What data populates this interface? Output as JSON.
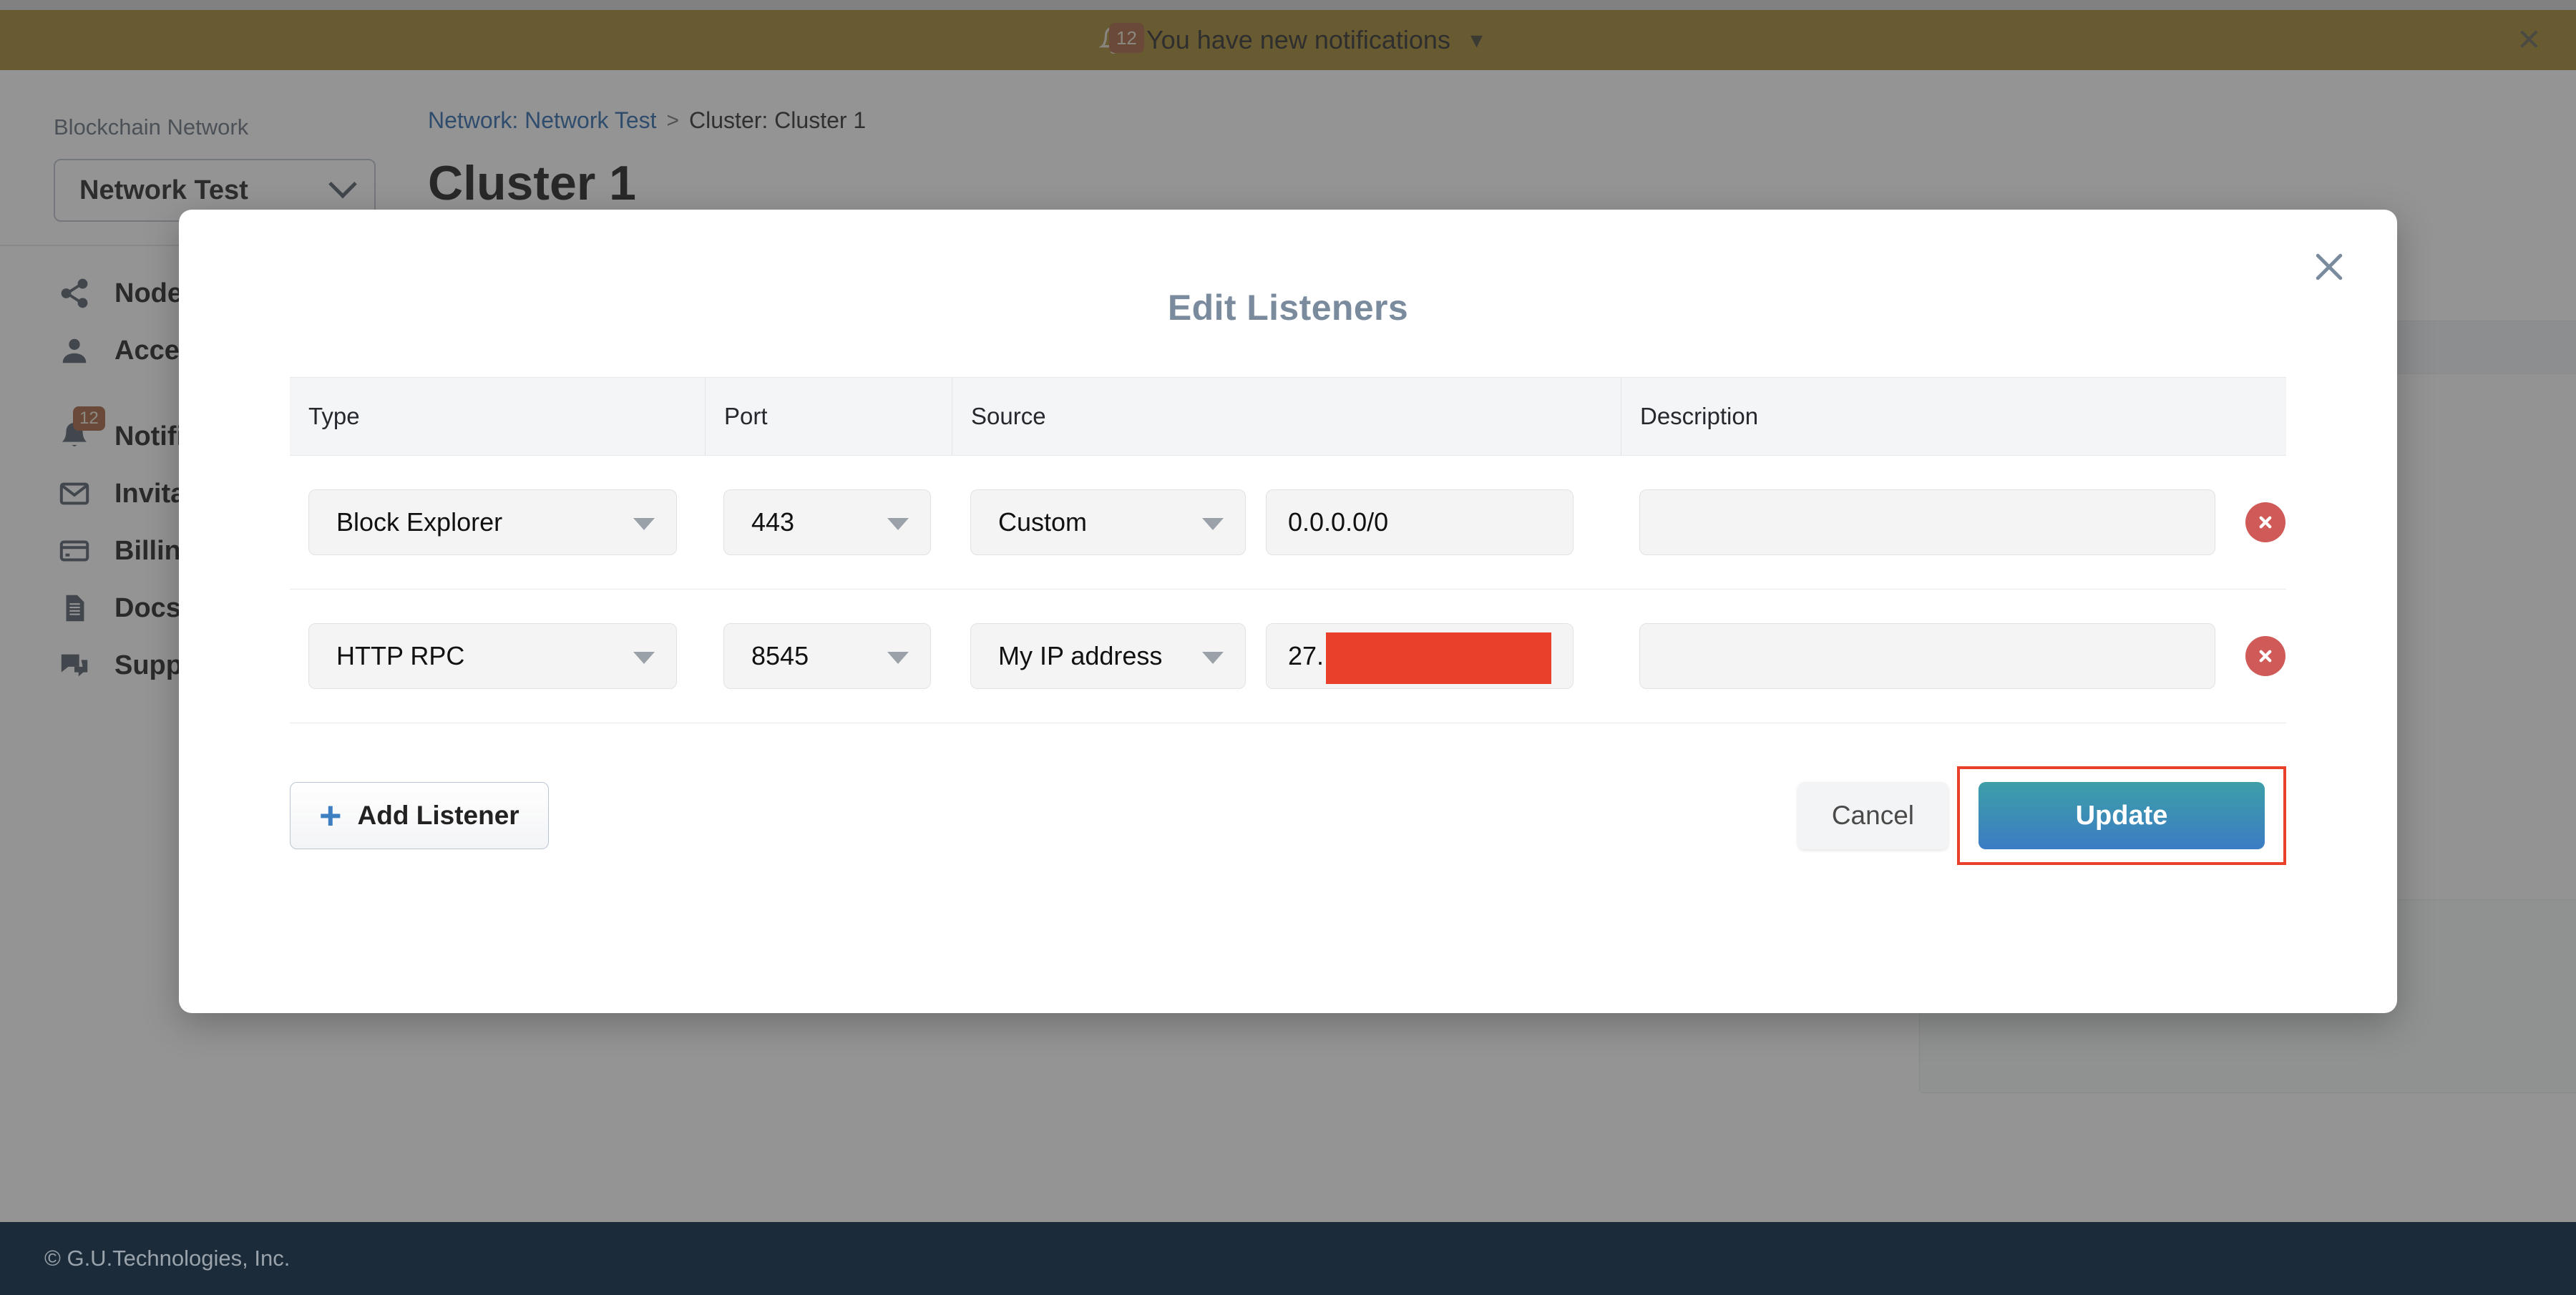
{
  "notification_bar": {
    "badge_count": "12",
    "message": "You have new notifications",
    "chevron_icon": "chevron-down-icon",
    "close_icon": "close-icon",
    "background_color": "#9d8225",
    "badge_color": "#a25a34"
  },
  "sidebar": {
    "network_label": "Blockchain Network",
    "network_selected": "Network Test",
    "items": [
      {
        "label": "Nodes",
        "icon": "share-nodes-icon",
        "badge": ""
      },
      {
        "label": "Access",
        "icon": "person-icon",
        "badge": ""
      },
      {
        "label": "Notifications",
        "icon": "bell-icon",
        "badge": "12"
      },
      {
        "label": "Invitations",
        "icon": "envelope-icon",
        "badge": ""
      },
      {
        "label": "Billing",
        "icon": "credit-card-icon",
        "badge": ""
      },
      {
        "label": "Docs",
        "icon": "document-icon",
        "badge": ""
      },
      {
        "label": "Support",
        "icon": "chat-bubbles-icon",
        "badge": ""
      }
    ]
  },
  "breadcrumb": {
    "network_link": "Network: Network Test",
    "separator": ">",
    "current": "Cluster: Cluster 1"
  },
  "page": {
    "title": "Cluster 1"
  },
  "footer": {
    "copyright": "© G.U.Technologies, Inc."
  },
  "modal": {
    "title": "Edit Listeners",
    "close_icon": "close-icon",
    "table": {
      "headers": [
        "Type",
        "Port",
        "Source",
        "Description"
      ],
      "rows": [
        {
          "type": "Block Explorer",
          "port": "443",
          "source": "Custom",
          "ip": "0.0.0.0/0",
          "ip_redacted": false,
          "description": "",
          "description_placeholder": "",
          "delete_icon": "delete-circle-icon"
        },
        {
          "type": "HTTP RPC",
          "port": "8545",
          "source": "My IP address",
          "ip": "27.",
          "ip_redacted": true,
          "description": "",
          "description_placeholder": "",
          "delete_icon": "delete-circle-icon"
        }
      ]
    },
    "add_listener_label": "Add Listener",
    "add_listener_icon": "plus-icon",
    "cancel_label": "Cancel",
    "update_label": "Update",
    "highlight_color": "#e8402a",
    "title_color": "#7b8b9e",
    "update_gradient_start": "#3d9fa8",
    "update_gradient_end": "#3b7cc4",
    "redaction_color": "#e8402a"
  }
}
